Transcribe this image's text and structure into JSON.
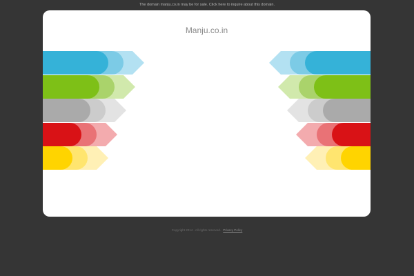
{
  "notice": {
    "text": "The domain manju.co.in may be for sale. Click here to inquire about this domain."
  },
  "card": {
    "title": "Manju.co.in"
  },
  "bands": [
    {
      "name": "blue",
      "dark": "#35b2d8",
      "mid": "#7ccbe6",
      "light": "#b3e1f2"
    },
    {
      "name": "green",
      "dark": "#7ec017",
      "mid": "#aad36b",
      "light": "#d1e9ac"
    },
    {
      "name": "gray",
      "dark": "#aaaaaa",
      "mid": "#cccccc",
      "light": "#e3e3e3"
    },
    {
      "name": "red",
      "dark": "#d91216",
      "mid": "#e97276",
      "light": "#f3abae"
    },
    {
      "name": "yellow",
      "dark": "#ffd400",
      "mid": "#ffe56f",
      "light": "#fff0b5"
    }
  ],
  "footer": {
    "copyright": "Copyright 2014 . All rights reserved.",
    "privacy_label": "Privacy Policy"
  }
}
